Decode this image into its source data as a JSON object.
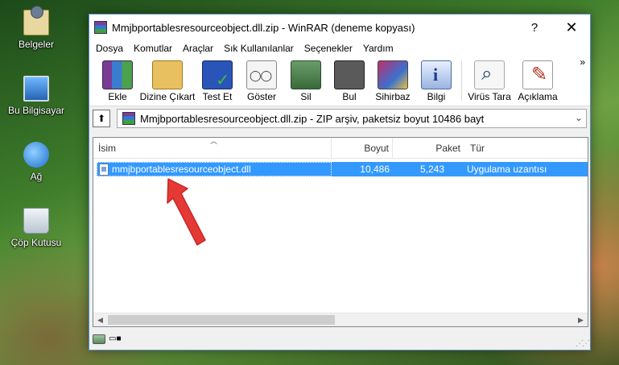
{
  "desktop": {
    "icons": [
      {
        "label": "Belgeler",
        "icon": "documents-folder-icon"
      },
      {
        "label": "Bu Bilgisayar",
        "icon": "computer-icon"
      },
      {
        "label": "Ağ",
        "icon": "network-icon"
      },
      {
        "label": "Çöp Kutusu",
        "icon": "recycle-bin-icon"
      }
    ]
  },
  "window": {
    "title": "Mmjbportablesresourceobject.dll.zip - WinRAR (deneme kopyası)",
    "help_label": "?",
    "close_label": "✕"
  },
  "menu": [
    "Dosya",
    "Komutlar",
    "Araçlar",
    "Sık Kullanılanlar",
    "Seçenekler",
    "Yardım"
  ],
  "toolbar": {
    "buttons": [
      {
        "label": "Ekle",
        "icon": "add-archive-icon"
      },
      {
        "label": "Dizine Çıkart",
        "icon": "extract-to-icon"
      },
      {
        "label": "Test Et",
        "icon": "test-icon"
      },
      {
        "label": "Göster",
        "icon": "view-icon"
      },
      {
        "label": "Sil",
        "icon": "delete-icon"
      },
      {
        "label": "Bul",
        "icon": "find-icon"
      },
      {
        "label": "Sihirbaz",
        "icon": "wizard-icon"
      },
      {
        "label": "Bilgi",
        "icon": "info-icon"
      },
      {
        "label": "Virüs Tara",
        "icon": "virus-scan-icon"
      },
      {
        "label": "Açıklama",
        "icon": "comment-icon"
      }
    ],
    "more_label": "»"
  },
  "address": {
    "path": "Mmjbportablesresourceobject.dll.zip - ZIP arşiv, paketsiz boyut 10486 bayt"
  },
  "filelist": {
    "columns": {
      "name": "İsim",
      "size": "Boyut",
      "packed": "Paket",
      "type": "Tür"
    },
    "rows": [
      {
        "name": "mmjbportablesresourceobject.dll",
        "size": "10,486",
        "packed": "5,243",
        "type": "Uygulama uzantısı",
        "selected": true
      }
    ]
  },
  "colors": {
    "selection": "#3399ff",
    "arrow": "#e53935",
    "window_border": "#5a8ac6"
  }
}
